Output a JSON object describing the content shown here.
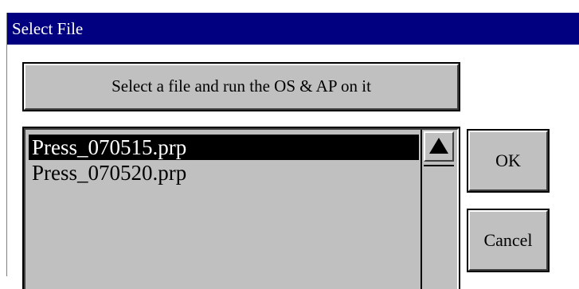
{
  "window": {
    "title": "Select File"
  },
  "instruction_label": "Select a file and run the OS & AP on it",
  "file_list": {
    "items": [
      {
        "label": "Press_070515.prp",
        "selected": true
      },
      {
        "label": "Press_070520.prp",
        "selected": false
      }
    ]
  },
  "buttons": {
    "ok_label": "OK",
    "cancel_label": "Cancel"
  },
  "icons": {
    "scroll_up": "triangle-up-icon"
  },
  "colors": {
    "titlebar": "#000080",
    "selection": "#000000",
    "face": "#c0c0c0"
  }
}
